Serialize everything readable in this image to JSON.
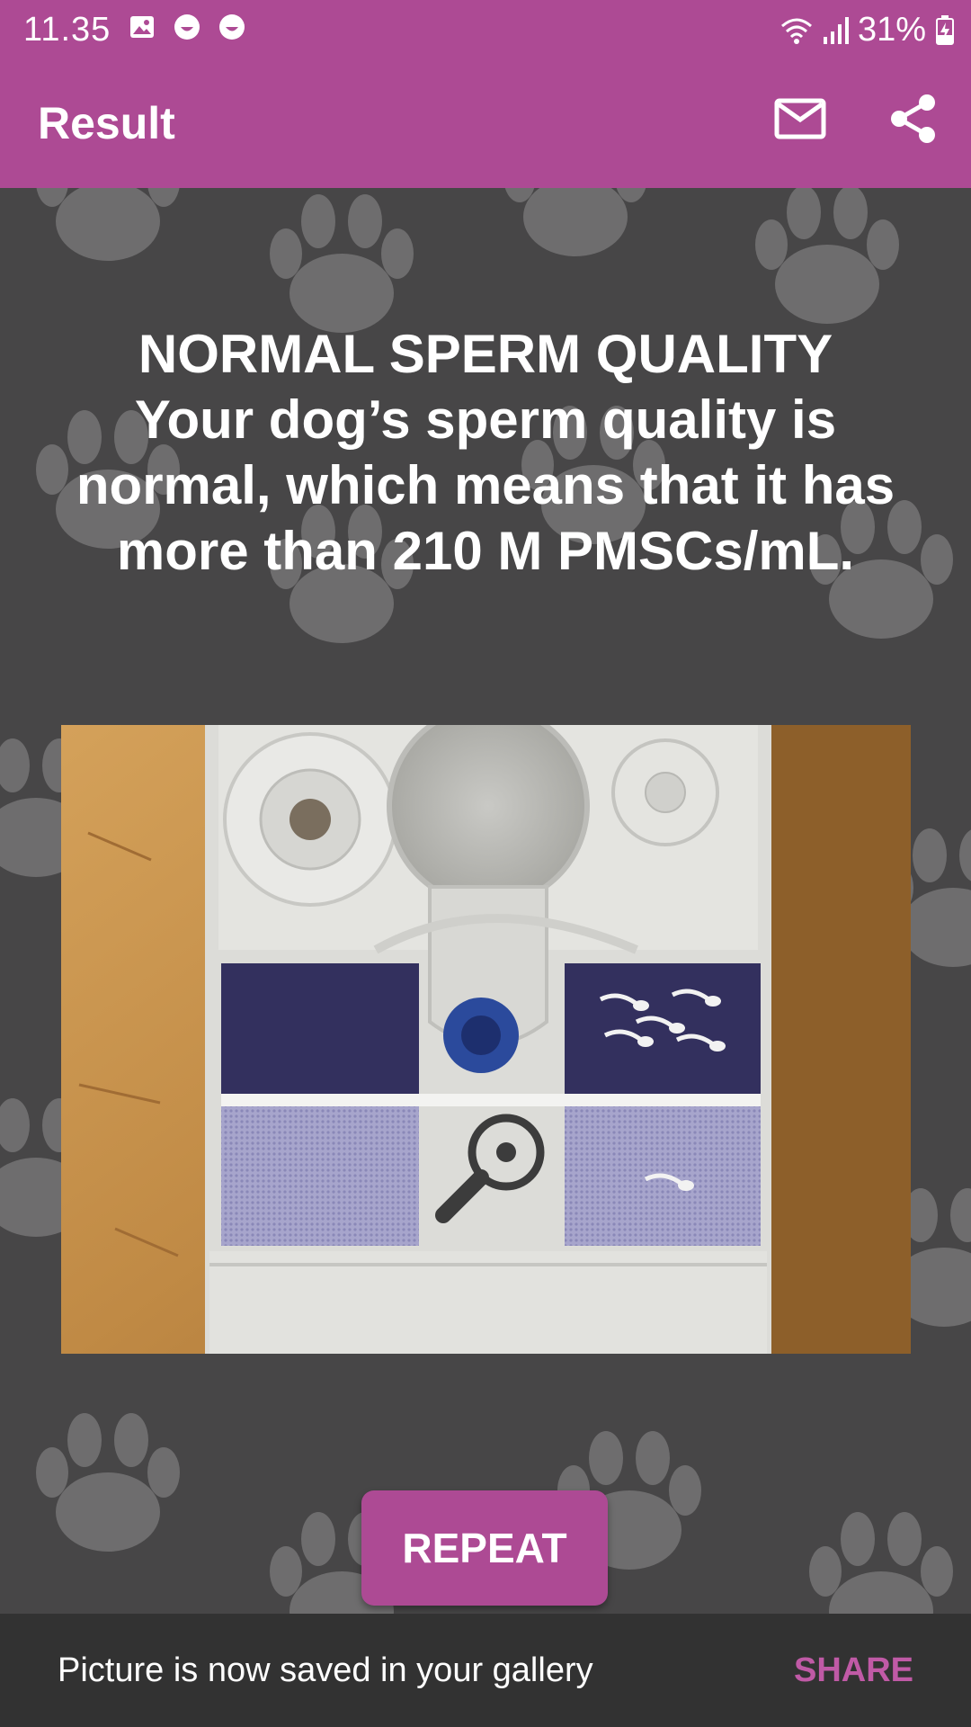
{
  "status_bar": {
    "time": "11.35",
    "battery": "31%",
    "icons": [
      "image-icon",
      "smiley-icon",
      "smiley-icon",
      "wifi-icon",
      "signal-icon",
      "battery-charging-icon"
    ]
  },
  "app_bar": {
    "title": "Result",
    "actions": [
      "mail-icon",
      "share-icon"
    ]
  },
  "result": {
    "heading": "NORMAL SPERM QUALITY",
    "description": "Your dog’s sperm quality is normal, which means that it has more than 210 M PMSCs/mL."
  },
  "repeat_button": {
    "label": "REPEAT"
  },
  "snackbar": {
    "message": "Picture is now saved in your gallery",
    "action": "SHARE"
  },
  "colors": {
    "primary": "#ad4a94",
    "background": "#474647",
    "paw": "#6e6d6e",
    "snackbar": "#323232",
    "snackbar_action": "#c05aa6"
  }
}
